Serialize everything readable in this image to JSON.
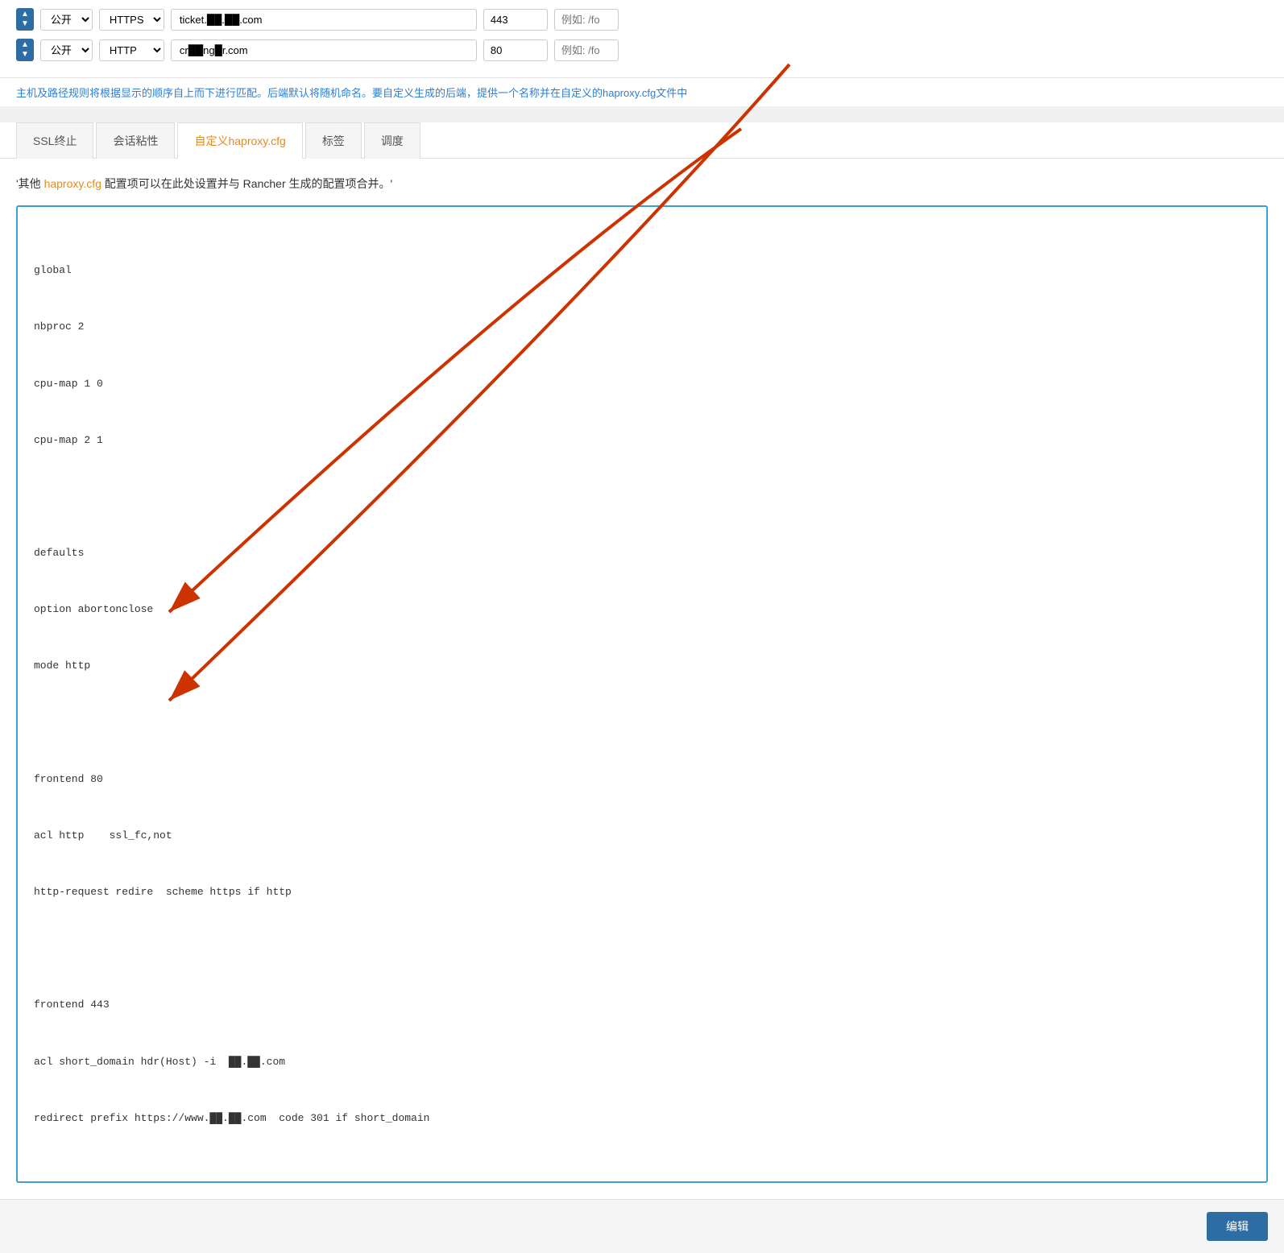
{
  "rows": [
    {
      "access": "公开",
      "protocol": "HTTPS",
      "domain": "ticket.██.██.com",
      "port": "443",
      "path_placeholder": "例如: /fo"
    },
    {
      "access": "公开",
      "protocol": "HTTP",
      "domain": "cr██ng█r.com",
      "port": "80",
      "path_placeholder": "例如: /fo"
    }
  ],
  "info_text": "主机及路径规则将根据显示的顺序自上而下进行匹配。后端默认将随机命名。要自定义生成的后端，提供一个名称并在自定义的haproxy.cfg文件中",
  "tabs": [
    {
      "label": "SSL终止",
      "active": false
    },
    {
      "label": "会话粘性",
      "active": false
    },
    {
      "label": "自定义haproxy.cfg",
      "active": true
    },
    {
      "label": "标签",
      "active": false
    },
    {
      "label": "调度",
      "active": false
    }
  ],
  "description": "'其他 haproxy.cfg 配置项可以在此处设置并与 Rancher 生成的配置项合并。'",
  "description_link": "haproxy.cfg",
  "code_lines": [
    "global",
    "nbproc 2",
    "cpu-map 1 0",
    "cpu-map 2 1",
    "",
    "defaults",
    "option abortonclose",
    "mode http",
    "",
    "frontend 80",
    "acl http    ssl_fc,not",
    "http-request redire  scheme https if http",
    "",
    "frontend 443",
    "acl short_domain hdr(Host) -i  ██.██.com",
    "redirect prefix https://www.██.██.com  code 301 if short_domain"
  ],
  "bottom": {
    "edit_label": "编辑"
  }
}
